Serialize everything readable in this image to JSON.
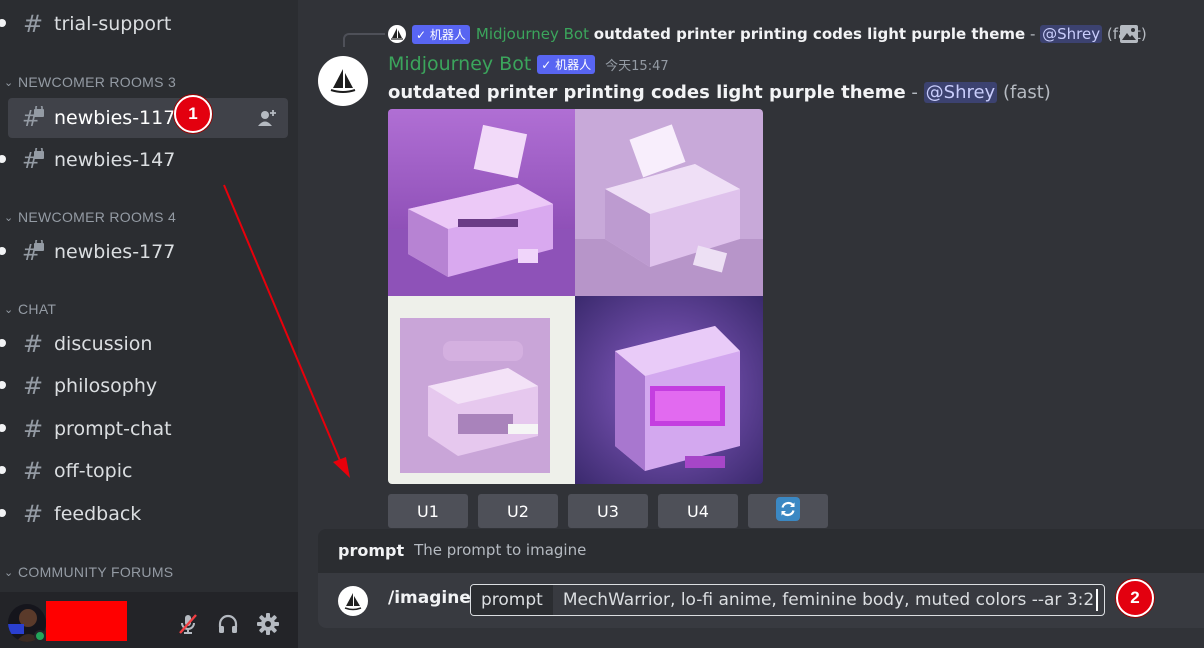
{
  "sidebar": {
    "channels": [
      {
        "name": "trial-support",
        "type": "text",
        "unread": true
      },
      {
        "name": "newbies-117",
        "type": "locked",
        "unread": false,
        "active": true
      },
      {
        "name": "newbies-147",
        "type": "locked",
        "unread": true
      },
      {
        "name": "newbies-177",
        "type": "locked",
        "unread": true
      },
      {
        "name": "discussion",
        "type": "text",
        "unread": true
      },
      {
        "name": "philosophy",
        "type": "text",
        "unread": true
      },
      {
        "name": "prompt-chat",
        "type": "text",
        "unread": true
      },
      {
        "name": "off-topic",
        "type": "text",
        "unread": true
      },
      {
        "name": "feedback",
        "type": "text",
        "unread": true
      }
    ],
    "categories": [
      "NEWCOMER ROOMS 3",
      "NEWCOMER ROOMS 4",
      "CHAT",
      "COMMUNITY FORUMS"
    ]
  },
  "annotations": {
    "badge1": "1",
    "badge2": "2",
    "arrow_color": "#e8000b"
  },
  "reply": {
    "tag": "✓ 机器人",
    "author": "Midjourney Bot",
    "prompt": "outdated printer printing codes light purple theme",
    "separator": " - ",
    "mention": "@Shrey",
    "speed": "(fast)"
  },
  "message": {
    "author": "Midjourney Bot",
    "tag": "✓ 机器人",
    "timestamp": "今天15:47",
    "prompt": "outdated printer printing codes light purple theme",
    "separator": " - ",
    "mention": "@Shrey",
    "speed": "(fast)",
    "buttons": [
      "U1",
      "U2",
      "U3",
      "U4"
    ],
    "reroll_icon": "refresh-icon"
  },
  "command": {
    "option_name": "prompt",
    "option_description": "The prompt to imagine",
    "slash": "/imagine",
    "option_key": "prompt",
    "option_value": "MechWarrior, lo-fi anime, feminine body, muted colors --ar 3:2"
  },
  "colors": {
    "bot_name": "#3ba55c",
    "tag_bg": "#5865f2",
    "badge_red": "#e3000f",
    "redaction": "#ff0000"
  }
}
